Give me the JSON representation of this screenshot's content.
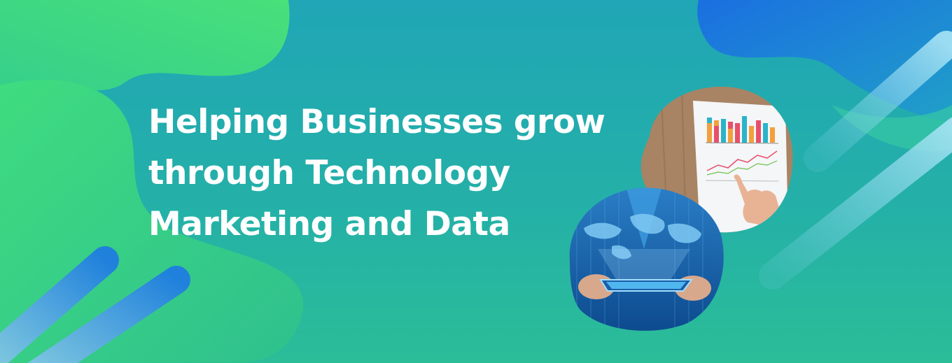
{
  "banner": {
    "headline": {
      "line1": "Helping Businesses grow",
      "line2": "through Technology",
      "line3": "Marketing and Data"
    },
    "colors": {
      "background_top": "#20a6b6",
      "background_bottom": "#2bbd98",
      "blob_green": "#3dd884",
      "blob_blue": "#1f86d8",
      "headline": "#ffffff"
    },
    "images": [
      {
        "name": "chart-report-photo",
        "depicts": "printed bar and line charts with a pointing hand on wooden desk"
      },
      {
        "name": "tablet-world-map-photo",
        "depicts": "businessman holding a tablet with a world map hologram"
      }
    ]
  }
}
